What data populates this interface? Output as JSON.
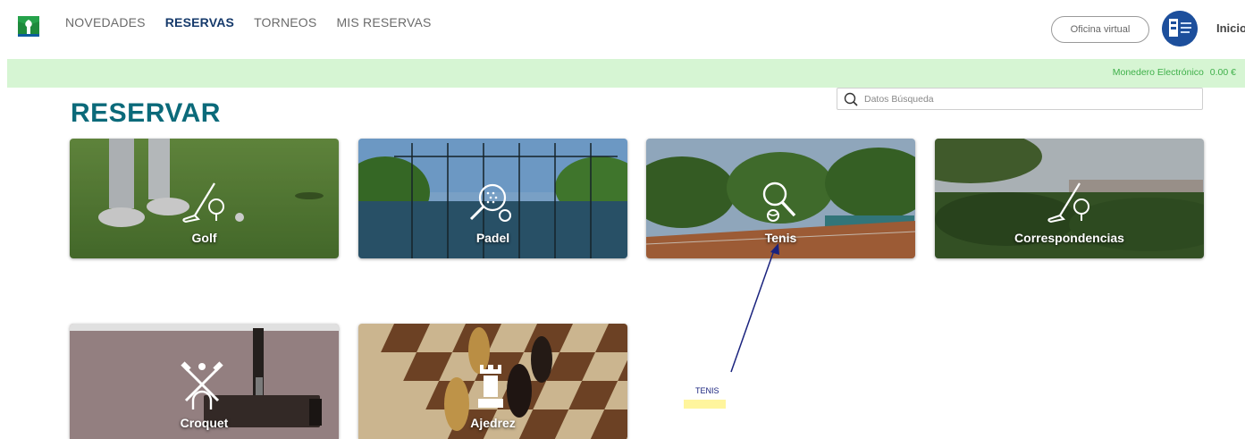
{
  "nav": {
    "items": [
      "NOVEDADES",
      "RESERVAS",
      "TORNEOS",
      "MIS RESERVAS"
    ],
    "active_index": 1
  },
  "header": {
    "oficina_label": "Oficina virtual",
    "inicio_label": "Inicio"
  },
  "wallet": {
    "label": "Monedero Electrónico",
    "amount": "0.00 €"
  },
  "search": {
    "placeholder": "Datos Búsqueda"
  },
  "page": {
    "title": "RESERVAR"
  },
  "cards": {
    "golf": "Golf",
    "padel": "Padel",
    "tenis": "Tenis",
    "correspondencias": "Correspondencias",
    "croquet": "Croquet",
    "ajedrez": "Ajedrez"
  },
  "annotation": {
    "text": "TENIS"
  },
  "colors": {
    "title": "#0b6a7a",
    "nav_active": "#163a6b",
    "green_bar": "#d6f5d3",
    "wallet_text": "#3fb04a"
  }
}
